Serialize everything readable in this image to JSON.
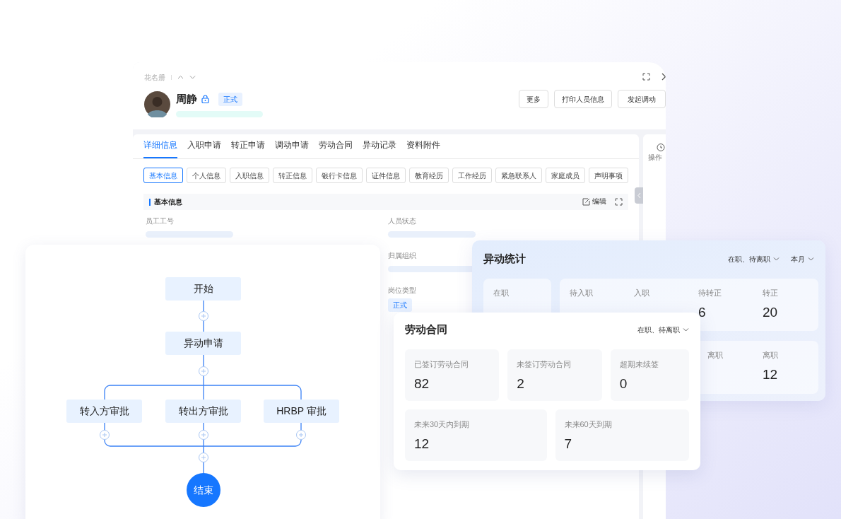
{
  "profile_window": {
    "breadcrumb": "花名册",
    "name": "周静",
    "status_tag": "正式",
    "buttons": [
      "更多",
      "打印人员信息",
      "发起调动"
    ],
    "tabs": [
      {
        "label": "详细信息",
        "selected": true
      },
      {
        "label": "入职申请",
        "selected": false
      },
      {
        "label": "转正申请",
        "selected": false
      },
      {
        "label": "调动申请",
        "selected": false
      },
      {
        "label": "劳动合同",
        "selected": false
      },
      {
        "label": "异动记录",
        "selected": false
      },
      {
        "label": "资料附件",
        "selected": false
      }
    ],
    "subtabs": [
      {
        "label": "基本信息",
        "selected": true
      },
      {
        "label": "个人信息",
        "selected": false
      },
      {
        "label": "入职信息",
        "selected": false
      },
      {
        "label": "转正信息",
        "selected": false
      },
      {
        "label": "银行卡信息",
        "selected": false
      },
      {
        "label": "证件信息",
        "selected": false
      },
      {
        "label": "教育经历",
        "selected": false
      },
      {
        "label": "工作经历",
        "selected": false
      },
      {
        "label": "紧急联系人",
        "selected": false
      },
      {
        "label": "家庭成员",
        "selected": false
      },
      {
        "label": "声明事项",
        "selected": false
      }
    ],
    "section": {
      "title": "基本信息",
      "edit": "编辑"
    },
    "fields": [
      {
        "label": "员工工号"
      },
      {
        "label": "人员状态"
      },
      {
        "label": "归属组织"
      },
      {
        "label": "岗位类型",
        "tag": "正式"
      }
    ],
    "side_panel": {
      "label": "操作"
    }
  },
  "flow": {
    "steps": [
      {
        "label": "开始"
      },
      {
        "label": "异动申请"
      }
    ],
    "branches": [
      {
        "label": "转入方审批"
      },
      {
        "label": "转出方审批"
      },
      {
        "label": "HRBP 审批"
      }
    ],
    "end": {
      "label": "结束"
    }
  },
  "change_stats": {
    "title": "异动统计",
    "filters": [
      "在职、待离职",
      "本月"
    ],
    "groups": [
      {
        "items": [
          {
            "label": "在职"
          }
        ]
      },
      {
        "items": [
          {
            "label": "待入职"
          },
          {
            "label": "入职"
          },
          {
            "label": "待转正",
            "value": "6"
          },
          {
            "label": "转正",
            "value": "20"
          }
        ]
      },
      {
        "items": [
          {
            "label": "离职"
          },
          {
            "label": "离职",
            "value": "12"
          }
        ]
      }
    ]
  },
  "labor_contract": {
    "title": "劳动合同",
    "filter": "在职、待离职",
    "rows": [
      [
        {
          "label": "已签订劳动合同",
          "value": "82"
        },
        {
          "label": "未签订劳动合同",
          "value": "2"
        },
        {
          "label": "超期未续签",
          "value": "0"
        }
      ],
      [
        {
          "label": "未来30天内到期",
          "value": "12"
        },
        {
          "label": "未来60天到期",
          "value": "7"
        }
      ]
    ]
  }
}
